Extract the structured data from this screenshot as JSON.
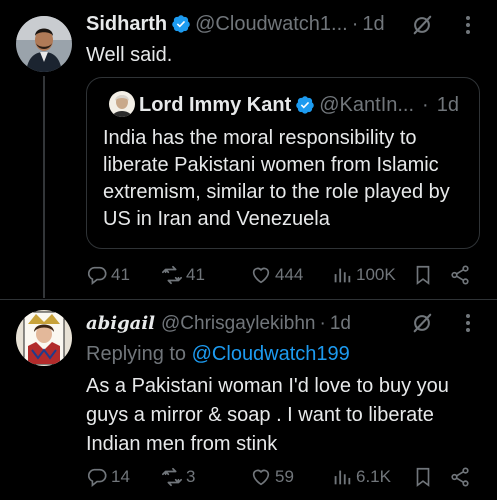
{
  "tweet1": {
    "name": "Sidharth",
    "handle": "@Cloudwatch1...",
    "separator": "·",
    "time": "1d",
    "text": "Well said.",
    "quote": {
      "name": "Lord Immy Kant",
      "handle": "@KantIn...",
      "separator": "·",
      "time": "1d",
      "text": "India has the moral responsibility to liberate Pakistani women from Islamic extremism, similar to the role played by US in Iran and Venezuela"
    },
    "actions": {
      "replies": "41",
      "reposts": "41",
      "likes": "444",
      "views": "100K"
    }
  },
  "tweet2": {
    "name": "abigail",
    "handle": "@Chrisgaylekibhn",
    "separator": "·",
    "time": "1d",
    "replying_prefix": "Replying to",
    "replying_to": "@Cloudwatch199",
    "text": "As a Pakistani woman I'd love to buy you guys a mirror & soap . I want to liberate Indian men from stink",
    "actions": {
      "replies": "14",
      "reposts": "3",
      "likes": "59",
      "views": "6.1K"
    }
  },
  "colors": {
    "accent": "#1d9bf0",
    "muted": "#71767b",
    "text": "#e7e9ea",
    "background": "#000000"
  },
  "icons": [
    "verified-badge-icon",
    "grok-icon",
    "more-icon",
    "reply-icon",
    "repost-icon",
    "like-icon",
    "views-icon",
    "bookmark-icon",
    "share-icon"
  ]
}
